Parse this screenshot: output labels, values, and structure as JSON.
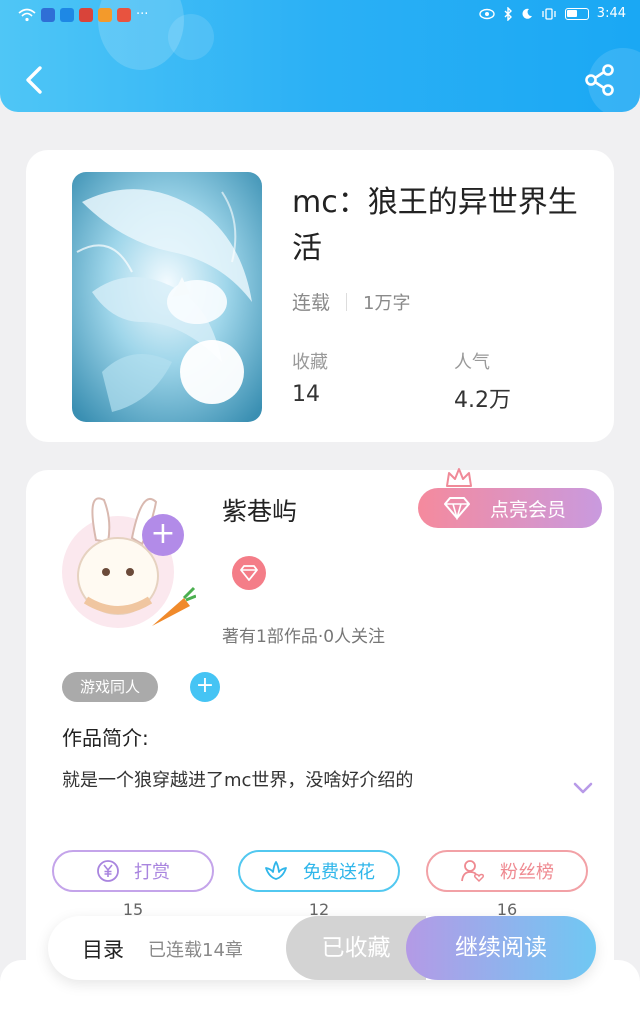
{
  "status_bar": {
    "time": "3:44",
    "more": "···"
  },
  "colors": {
    "header": "#2bb0f5",
    "accent_purple": "#b28be8",
    "accent_blue": "#45c4f4",
    "vip_pink": "#f58a9d"
  },
  "header": {
    "back_icon": "chevron-left-icon",
    "share_icon": "share-icon"
  },
  "book": {
    "title": "mc：狼王的异世界生活",
    "status": "连载",
    "word_count": "1万字",
    "favorites_label": "收藏",
    "favorites_value": "14",
    "popularity_label": "人气",
    "popularity_value": "4.2万"
  },
  "author": {
    "name": "紫巷屿",
    "vip_label": "点亮会员",
    "stats": "著有1部作品·0人关注",
    "follow": "+"
  },
  "tags": {
    "items": [
      "游戏同人"
    ],
    "add": "+"
  },
  "intro": {
    "title": "作品简介:",
    "text": "就是一个狼穿越进了mc世界，没啥好介绍的"
  },
  "actions": [
    {
      "label": "打赏",
      "count": "15",
      "icon": "yuan-coin-icon"
    },
    {
      "label": "免费送花",
      "count": "12",
      "icon": "flower-icon"
    },
    {
      "label": "粉丝榜",
      "count": "16",
      "icon": "fan-user-heart-icon"
    }
  ],
  "bottom_bar": {
    "toc_label": "目录",
    "toc_count": "已连载14章",
    "collected": "已收藏",
    "continue": "继续阅读"
  }
}
